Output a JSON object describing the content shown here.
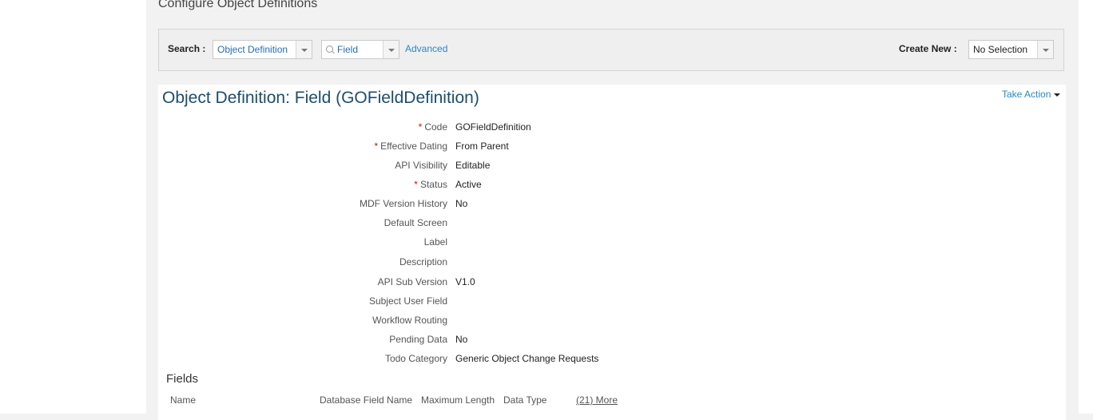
{
  "page": {
    "title": "Configure Object Definitions"
  },
  "search": {
    "label": "Search :",
    "type_value": "Object Definition",
    "query_value": "Field",
    "advanced_label": "Advanced",
    "create_label": "Create New :",
    "create_value": "No Selection"
  },
  "panel": {
    "title": "Object Definition: Field (GOFieldDefinition)",
    "take_action_label": "Take Action",
    "fields": [
      {
        "label": "Code",
        "required": "*",
        "value": "GOFieldDefinition"
      },
      {
        "label": "Effective Dating",
        "required": "*",
        "value": "From Parent"
      },
      {
        "label": "API Visibility",
        "required": "",
        "value": "Editable"
      },
      {
        "label": "Status",
        "required": "*",
        "value": "Active"
      },
      {
        "label": "MDF Version History",
        "required": "",
        "value": "No"
      },
      {
        "label": "Default Screen",
        "required": "",
        "value": ""
      },
      {
        "label": "Label",
        "required": "",
        "value": ""
      },
      {
        "label": "Description",
        "required": "",
        "value": ""
      },
      {
        "label": "API Sub Version",
        "required": "",
        "value": "V1.0"
      },
      {
        "label": "Subject User Field",
        "required": "",
        "value": ""
      },
      {
        "label": "Workflow Routing",
        "required": "",
        "value": ""
      },
      {
        "label": "Pending Data",
        "required": "",
        "value": "No"
      },
      {
        "label": "Todo Category",
        "required": "",
        "value": "Generic Object Change Requests"
      }
    ]
  },
  "fields_section": {
    "title": "Fields",
    "columns": [
      "Name",
      "Database Field Name",
      "Maximum Length",
      "Data Type"
    ],
    "more_label": "(21) More"
  },
  "colors": {
    "accent": "#2a87c8",
    "title": "#1d4d6b",
    "required": "#cc1111"
  }
}
